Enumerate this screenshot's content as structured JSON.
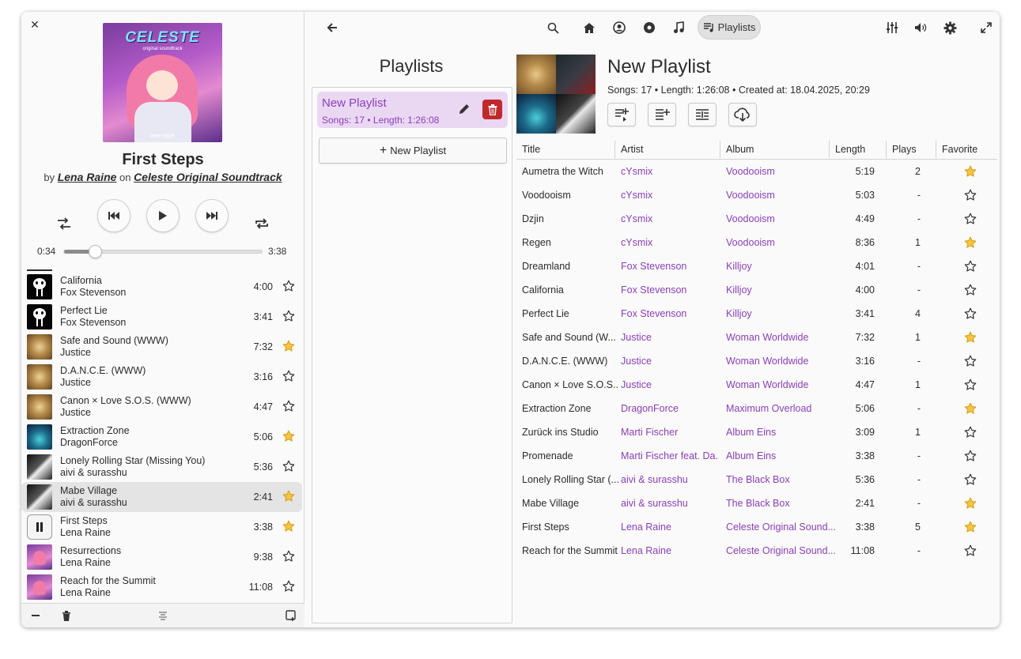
{
  "player": {
    "now_playing": {
      "title": "First Steps",
      "by_prefix": "by",
      "artist": "Lena Raine",
      "on_word": "on",
      "album": "Celeste Original Soundtrack",
      "cover_logo": "CELESTE",
      "cover_sub": "original soundtrack",
      "cover_artist": "lena raine"
    },
    "position": "0:34",
    "duration": "3:38",
    "progress_fraction": 0.156,
    "queue": [
      {
        "title": "California",
        "artist": "Fox Stevenson",
        "length": "4:00",
        "favorite": false,
        "art": "killjoy"
      },
      {
        "title": "Perfect Lie",
        "artist": "Fox Stevenson",
        "length": "3:41",
        "favorite": false,
        "art": "killjoy"
      },
      {
        "title": "Safe and Sound (WWW)",
        "artist": "Justice",
        "length": "7:32",
        "favorite": true,
        "art": "justice"
      },
      {
        "title": "D.A.N.C.E. (WWW)",
        "artist": "Justice",
        "length": "3:16",
        "favorite": false,
        "art": "justice"
      },
      {
        "title": "Canon × Love S.O.S. (WWW)",
        "artist": "Justice",
        "length": "4:47",
        "favorite": false,
        "art": "justice"
      },
      {
        "title": "Extraction Zone",
        "artist": "DragonForce",
        "length": "5:06",
        "favorite": true,
        "art": "dragonforce"
      },
      {
        "title": "Lonely Rolling Star (Missing You)",
        "artist": "aivi & surasshu",
        "length": "5:36",
        "favorite": false,
        "art": "blackbox"
      },
      {
        "title": "Mabe Village",
        "artist": "aivi & surasshu",
        "length": "2:41",
        "favorite": true,
        "art": "blackbox"
      },
      {
        "title": "First Steps",
        "artist": "Lena Raine",
        "length": "3:38",
        "favorite": true,
        "art": "playing"
      },
      {
        "title": "Resurrections",
        "artist": "Lena Raine",
        "length": "9:38",
        "favorite": false,
        "art": "celeste"
      },
      {
        "title": "Reach for the Summit",
        "artist": "Lena Raine",
        "length": "11:08",
        "favorite": false,
        "art": "celeste"
      }
    ]
  },
  "header": {
    "active_tab_label": "Playlists",
    "icons": [
      "back-icon",
      "search-icon",
      "home-icon",
      "artists-icon",
      "albums-icon",
      "songs-icon",
      "playlists-icon",
      "equalizer-icon",
      "volume-icon",
      "settings-icon",
      "fullscreen-icon"
    ]
  },
  "playlists": {
    "heading": "Playlists",
    "items": [
      {
        "name": "New Playlist",
        "meta": "Songs: 17  •  Length: 1:26:08"
      }
    ],
    "new_button_label": "New Playlist"
  },
  "detail": {
    "title": "New Playlist",
    "meta": "Songs: 17 • Length: 1:26:08 • Created at: 18.04.2025, 20:29",
    "columns": [
      "Title",
      "Artist",
      "Album",
      "Length",
      "Plays",
      "Favorite"
    ],
    "rows": [
      {
        "title": "Aumetra the Witch",
        "artist": "cYsmix",
        "album": "Voodooism",
        "length": "5:19",
        "plays": "2",
        "favorite": true
      },
      {
        "title": "Voodooism",
        "artist": "cYsmix",
        "album": "Voodooism",
        "length": "5:03",
        "plays": "-",
        "favorite": false
      },
      {
        "title": "Dzjin",
        "artist": "cYsmix",
        "album": "Voodooism",
        "length": "4:49",
        "plays": "-",
        "favorite": false
      },
      {
        "title": "Regen",
        "artist": "cYsmix",
        "album": "Voodooism",
        "length": "8:36",
        "plays": "1",
        "favorite": true
      },
      {
        "title": "Dreamland",
        "artist": "Fox Stevenson",
        "album": "Killjoy",
        "length": "4:01",
        "plays": "-",
        "favorite": false
      },
      {
        "title": "California",
        "artist": "Fox Stevenson",
        "album": "Killjoy",
        "length": "4:00",
        "plays": "-",
        "favorite": false
      },
      {
        "title": "Perfect Lie",
        "artist": "Fox Stevenson",
        "album": "Killjoy",
        "length": "3:41",
        "plays": "4",
        "favorite": false
      },
      {
        "title": "Safe and Sound (W...",
        "artist": "Justice",
        "album": "Woman Worldwide",
        "length": "7:32",
        "plays": "1",
        "favorite": true
      },
      {
        "title": "D.A.N.C.E. (WWW)",
        "artist": "Justice",
        "album": "Woman Worldwide",
        "length": "3:16",
        "plays": "-",
        "favorite": false
      },
      {
        "title": "Canon × Love S.O.S....",
        "artist": "Justice",
        "album": "Woman Worldwide",
        "length": "4:47",
        "plays": "1",
        "favorite": false
      },
      {
        "title": "Extraction Zone",
        "artist": "DragonForce",
        "album": "Maximum Overload",
        "length": "5:06",
        "plays": "-",
        "favorite": true
      },
      {
        "title": "Zurück ins Studio",
        "artist": "Marti Fischer",
        "album": "Album Eins",
        "length": "3:09",
        "plays": "1",
        "favorite": false
      },
      {
        "title": "Promenade",
        "artist": "Marti Fischer feat. Da...",
        "album": "Album Eins",
        "length": "3:38",
        "plays": "-",
        "favorite": false
      },
      {
        "title": "Lonely Rolling Star (...",
        "artist": "aivi & surasshu",
        "album": "The Black Box",
        "length": "5:36",
        "plays": "-",
        "favorite": false
      },
      {
        "title": "Mabe Village",
        "artist": "aivi & surasshu",
        "album": "The Black Box",
        "length": "2:41",
        "plays": "-",
        "favorite": true
      },
      {
        "title": "First Steps",
        "artist": "Lena Raine",
        "album": "Celeste Original Sound...",
        "length": "3:38",
        "plays": "5",
        "favorite": true
      },
      {
        "title": "Reach for the Summit",
        "artist": "Lena Raine",
        "album": "Celeste Original Sound...",
        "length": "11:08",
        "plays": "-",
        "favorite": false
      }
    ]
  },
  "colors": {
    "accent": "#8a3fb8",
    "star_filled": "#f5c542",
    "delete": "#c0282b",
    "selected_bg": "#ead8f3"
  }
}
